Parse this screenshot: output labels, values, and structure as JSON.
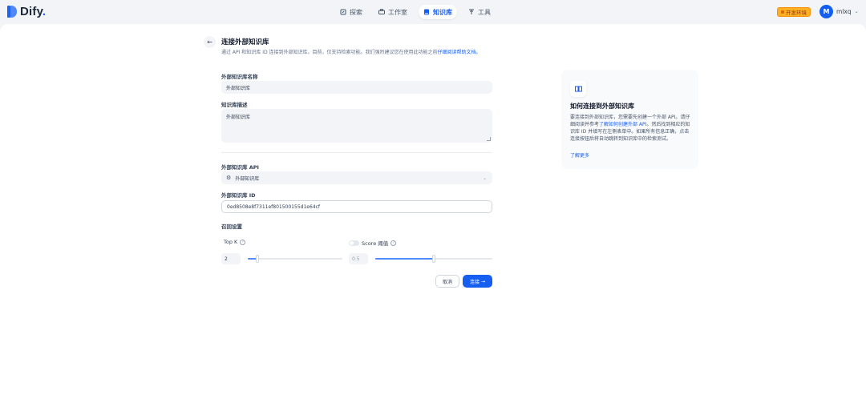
{
  "app": {
    "name": "Dify",
    "name_dot": "."
  },
  "nav": [
    {
      "label": "探索",
      "icon": "explore-icon",
      "active": false
    },
    {
      "label": "工作室",
      "icon": "studio-icon",
      "active": false
    },
    {
      "label": "知识库",
      "icon": "book-icon",
      "active": true
    },
    {
      "label": "工具",
      "icon": "tools-icon",
      "active": false
    }
  ],
  "env_badge": "开发环境",
  "user": {
    "initial": "M",
    "name": "mlxq"
  },
  "page": {
    "title": "连接外部知识库",
    "desc": "通过 API 和知识库 ID 连接到外部知识库。目前，仅支持检索功能。我们强烈建议您在使用此功能之前",
    "desc_link": "仔细阅读帮助文档。"
  },
  "form": {
    "name_label": "外部知识库名称",
    "name_value": "外部知识库",
    "desc_label": "知识库描述",
    "desc_value": "外部知识库",
    "api_label": "外部知识库 API",
    "api_value": "外部知识库",
    "id_label": "外部知识库 ID",
    "id_value": "0ed8508e8f7311ef801500155d1e64cf",
    "retrieval_label": "召回设置",
    "topk_label": "Top K",
    "topk_value": "2",
    "topk_fraction": 0.1,
    "score_label": "Score 阈值",
    "score_value": "0.5",
    "score_enabled": false,
    "score_fraction": 0.5,
    "cancel_label": "取消",
    "connect_label": "连接"
  },
  "help_card": {
    "title": "如何连接到外部知识库",
    "body_1": "要连接到外部知识库，您需要先创建一个外部 API。请仔细阅读并参考",
    "body_link": "了解如何创建外部 API",
    "body_2": "。然后找到相应的知识库 ID 并填写在左侧表单中。如果所有信息正确，点击连接按钮后将自动跳转到知识库中的检索测试。",
    "more": "了解更多"
  },
  "colors": {
    "accent": "#155eef",
    "badge": "#fdb022"
  }
}
